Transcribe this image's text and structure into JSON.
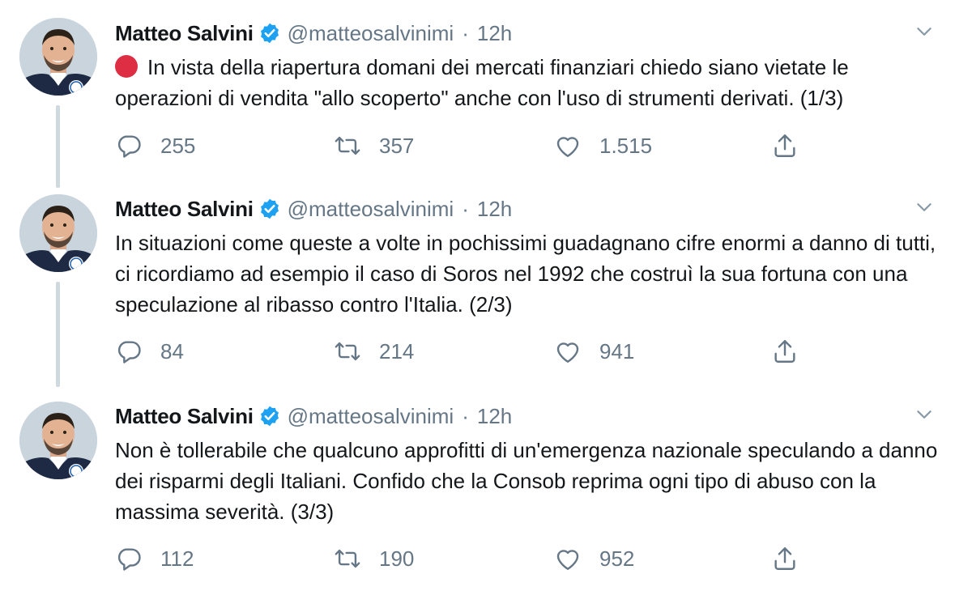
{
  "tweets": [
    {
      "author": {
        "name": "Matteo Salvini",
        "handle": "@matteosalvinimi"
      },
      "separator": "·",
      "time": "12h",
      "leading_emoji": "red-circle",
      "text": "In vista della riapertura domani dei mercati finanziari chiedo siano vietate le operazioni di vendita \"allo scoperto\" anche con l'uso di strumenti derivati. (1/3)",
      "replies": "255",
      "retweets": "357",
      "likes": "1.515"
    },
    {
      "author": {
        "name": "Matteo Salvini",
        "handle": "@matteosalvinimi"
      },
      "separator": "·",
      "time": "12h",
      "text": "In situazioni come queste a volte in pochissimi guadagnano cifre enormi a danno di tutti, ci ricordiamo ad esempio il caso di Soros nel 1992 che costruì la sua fortuna con una speculazione al ribasso contro l'Italia. (2/3)",
      "replies": "84",
      "retweets": "214",
      "likes": "941"
    },
    {
      "author": {
        "name": "Matteo Salvini",
        "handle": "@matteosalvinimi"
      },
      "separator": "·",
      "time": "12h",
      "text": "Non è tollerabile che qualcuno approfitti di un'emergenza nazionale speculando a danno dei risparmi degli Italiani. Confido che la Consob reprima ogni tipo di abuso con la massima severità. (3/3)",
      "replies": "112",
      "retweets": "190",
      "likes": "952"
    }
  ],
  "icons": {
    "verified": "verified-badge-icon",
    "more": "chevron-down-icon",
    "reply": "reply-icon",
    "retweet": "retweet-icon",
    "like": "heart-icon",
    "share": "share-icon"
  },
  "colors": {
    "accent": "#1da1f2",
    "text": "#14171a",
    "secondary": "#657786",
    "thread_line": "#cfd9de",
    "red_emoji": "#dd2e44"
  }
}
